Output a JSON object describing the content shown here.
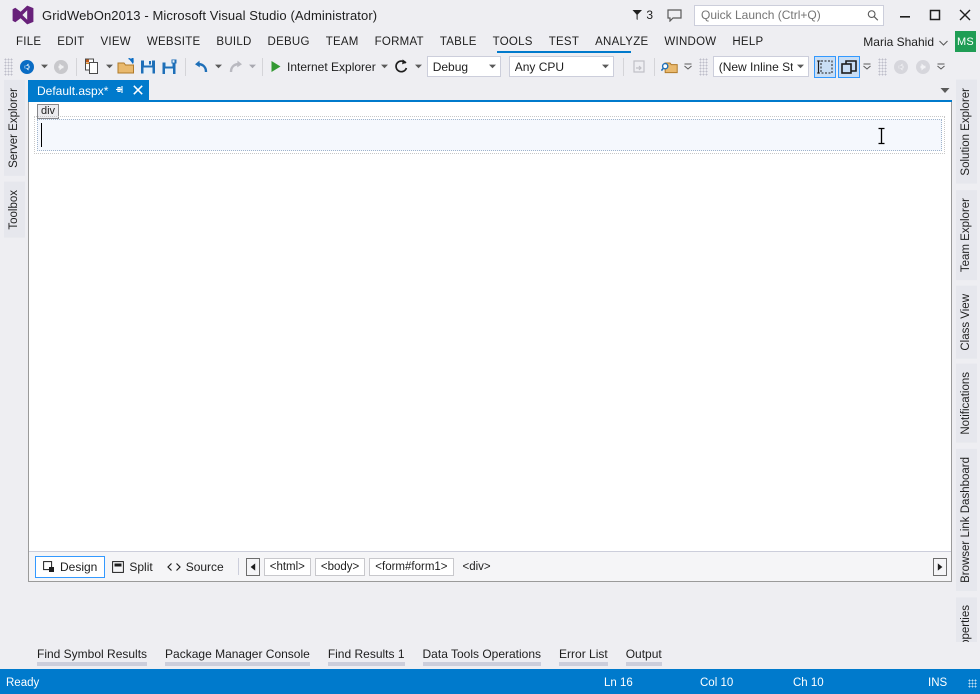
{
  "window": {
    "title": "GridWebOn2013 - Microsoft Visual Studio (Administrator)",
    "logo_icon": "visual-studio-logo",
    "notification_count": "3",
    "notification_icon": "flag-icon",
    "feedback_icon": "feedback-balloon-icon",
    "minimize_icon": "minimize-icon",
    "maximize_icon": "maximize-icon",
    "close_icon": "close-icon"
  },
  "quick_launch": {
    "placeholder": "Quick Launch (Ctrl+Q)",
    "value": "",
    "search_icon": "search-icon"
  },
  "menu": {
    "items": [
      {
        "label": "FILE"
      },
      {
        "label": "EDIT"
      },
      {
        "label": "VIEW"
      },
      {
        "label": "WEBSITE"
      },
      {
        "label": "BUILD"
      },
      {
        "label": "DEBUG"
      },
      {
        "label": "TEAM"
      },
      {
        "label": "FORMAT"
      },
      {
        "label": "TABLE"
      },
      {
        "label": "TOOLS"
      },
      {
        "label": "TEST"
      },
      {
        "label": "ANALYZE"
      },
      {
        "label": "WINDOW"
      },
      {
        "label": "HELP"
      }
    ],
    "user_name": "Maria Shahid",
    "user_caret_icon": "chevron-down-icon",
    "avatar_initials": "MS"
  },
  "toolbar": {
    "navigate_back_icon": "navigate-back-icon",
    "navigate_back_caret_icon": "chevron-down-icon",
    "navigate_forward_icon": "navigate-forward-icon",
    "new_item_icon": "new-item-icon",
    "new_item_caret_icon": "chevron-down-icon",
    "open_file_icon": "open-file-icon",
    "save_icon": "save-icon",
    "save_all_icon": "save-all-icon",
    "undo_icon": "undo-icon",
    "undo_caret_icon": "chevron-down-icon",
    "redo_icon": "redo-icon",
    "redo_caret_icon": "chevron-down-icon",
    "start_icon": "play-triangle-icon",
    "start_label": "Internet Explorer",
    "start_caret_icon": "chevron-down-icon",
    "refresh_icon": "refresh-icon",
    "refresh_caret_icon": "chevron-down-icon",
    "configuration": "Debug",
    "configuration_caret_icon": "chevron-down-icon",
    "platform": "Any CPU",
    "platform_caret_icon": "chevron-down-icon",
    "step_icon": "step-into-icon",
    "find_window_icon": "find-in-files-icon",
    "find_window_overflow_icon": "overflow-chevron-icon",
    "style_value": "(New Inline Style",
    "style_caret_icon": "chevron-down-icon",
    "select_tag_icon": "select-tag-icon",
    "expand_recess_icon": "expand-recess-icon",
    "quotes_overflow_icon": "overflow-chevron-icon",
    "nav_prev_icon": "circle-left-arrow-icon",
    "nav_next_icon": "circle-right-arrow-icon",
    "tail_overflow_icon": "overflow-chevron-icon"
  },
  "dock_left": {
    "items": [
      {
        "label": "Server Explorer"
      },
      {
        "label": "Toolbox"
      }
    ]
  },
  "dock_right": {
    "items": [
      {
        "label": "Solution Explorer"
      },
      {
        "label": "Team Explorer"
      },
      {
        "label": "Class View"
      },
      {
        "label": "Notifications"
      },
      {
        "label": "Browser Link Dashboard"
      },
      {
        "label": "Properties"
      }
    ]
  },
  "document": {
    "tab_label": "Default.aspx*",
    "pin_icon": "pin-icon",
    "close_icon": "close-icon",
    "tab_list_icon": "chevron-down-icon",
    "tag_badge": "div",
    "cursor_icon": "text-ibeam-cursor"
  },
  "view_bar": {
    "design_label": "Design",
    "design_icon": "design-view-icon",
    "split_label": "Split",
    "split_icon": "split-view-icon",
    "source_label": "Source",
    "source_icon": "source-view-icon",
    "scroll_left_icon": "triangle-left-icon",
    "scroll_right_icon": "triangle-right-icon",
    "breadcrumbs": [
      {
        "label": "<html>"
      },
      {
        "label": "<body>"
      },
      {
        "label": "<form#form1>"
      },
      {
        "label": "<div>"
      }
    ]
  },
  "bottom_tabs": {
    "items": [
      {
        "label": "Find Symbol Results"
      },
      {
        "label": "Package Manager Console"
      },
      {
        "label": "Find Results 1"
      },
      {
        "label": "Data Tools Operations"
      },
      {
        "label": "Error List"
      },
      {
        "label": "Output"
      }
    ]
  },
  "status_bar": {
    "message": "Ready",
    "line": "Ln 16",
    "column": "Col 10",
    "character": "Ch 10",
    "insert_mode": "INS"
  },
  "colors": {
    "accent": "#007acc",
    "chrome": "#eeeef2",
    "avatar": "#1f9d55",
    "vs_purple": "#68217a",
    "start_green": "#339933"
  }
}
